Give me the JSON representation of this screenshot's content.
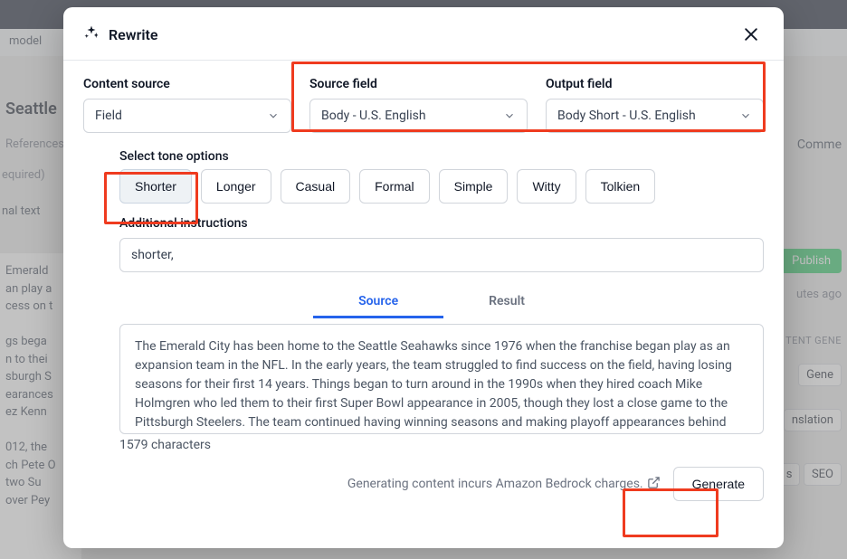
{
  "background": {
    "model_label": "model",
    "title_fragment": "Seattle",
    "refs": "References",
    "required": "equired)",
    "nal_text": "nal text",
    "comments": "Comme",
    "publish": "Publish",
    "ago": "utes ago",
    "tent_gene": "TENT GENE",
    "gene": "Gene",
    "nslation": "nslation",
    "s": "s",
    "seo": "SEO",
    "p1": "Emerald",
    "p2": "an play a",
    "p3": "cess on t",
    "p4": "gs bega",
    "p5": "n to thei",
    "p6": "sburgh S",
    "p7": "earances",
    "p8": "ez Kenn",
    "p9": "012, the",
    "p10": "ch Pete O",
    "p11": "two Su",
    "p12": "over Pey"
  },
  "modal": {
    "title": "Rewrite",
    "content_source_label": "Content source",
    "content_source_value": "Field",
    "source_field_label": "Source field",
    "source_field_value": "Body - U.S. English",
    "output_field_label": "Output field",
    "output_field_value": "Body Short - U.S. English",
    "tone_label": "Select tone options",
    "tones": [
      "Shorter",
      "Longer",
      "Casual",
      "Formal",
      "Simple",
      "Witty",
      "Tolkien"
    ],
    "tone_selected_index": 0,
    "additional_label": "Additional instructions",
    "additional_value": "shorter,",
    "tabs": {
      "source": "Source",
      "result": "Result"
    },
    "source_text": "The Emerald City has been home to the Seattle Seahawks since 1976 when the franchise began play as an expansion team in the NFL. In the early years, the team struggled to find success on the field, having losing seasons for their first 14 years. Things began to turn around in the 1990s when they hired coach Mike Holmgren who led them to their first Super Bowl appearance in 2005, though they lost a close game to the Pittsburgh Steelers. The team continued having winning seasons and making playoff appearances behind stars like Shaun Alexander, Matt Hasselbeck, Walter Jones and",
    "char_count": "1579 characters",
    "notice": "Generating content incurs Amazon Bedrock charges.",
    "generate": "Generate"
  }
}
